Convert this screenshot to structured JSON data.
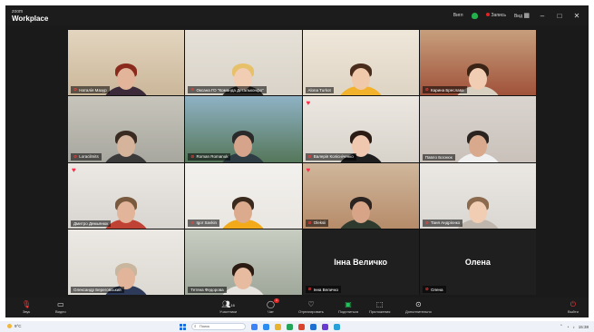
{
  "app": {
    "brand_small": "zoom",
    "brand_large": "Workplace"
  },
  "titlebar": {
    "view_label": "Вигл",
    "rec_label": "Запись",
    "grid_label": "Вид",
    "window_controls": [
      "minimize-icon",
      "maximize-icon",
      "close-icon"
    ]
  },
  "participants": [
    {
      "name": "Наталія Мазур",
      "mic_off": true,
      "heart": false,
      "bg": "#cbb79a",
      "wall": "#e3d5bf",
      "skin": "#e2b59b",
      "hair": "#8a2a1d",
      "shirt": "#3b2b3a"
    },
    {
      "name": "Оксана ГО \"Команда Детальконфо\"",
      "mic_off": true,
      "heart": false,
      "bg": "#d9d3c9",
      "wall": "#e6e1d8",
      "skin": "#f1cdb3",
      "hair": "#e7c06a",
      "shirt": "#2e2b28"
    },
    {
      "name": "Alona Turkot",
      "mic_off": false,
      "heart": false,
      "bg": "#ded4c4",
      "wall": "#efe7da",
      "skin": "#f0c8aa",
      "hair": "#4a2c1c",
      "shirt": "#f2b22b"
    },
    {
      "name": "Карина Бреслава",
      "mic_off": true,
      "heart": false,
      "bg": "#a0523a",
      "wall": "#c79f7d",
      "skin": "#f1cdb3",
      "hair": "#3b2416",
      "shirt": "#d8d0c0"
    },
    {
      "name": "Loracilmits",
      "mic_off": true,
      "heart": false,
      "bg": "#a8a79f",
      "wall": "#c7c5bb",
      "skin": "#d6b39b",
      "hair": "#3a2b22",
      "shirt": "#3a3a3a"
    },
    {
      "name": "Roman Romanuk",
      "mic_off": true,
      "heart": false,
      "bg": "#55775a",
      "wall": "#8fb2c5",
      "skin": "#d6a48a",
      "hair": "#2a2a2a",
      "shirt": "#2e3d44"
    },
    {
      "name": "Валерія Колісніченко",
      "mic_off": true,
      "heart": true,
      "bg": "#d7d2ca",
      "wall": "#ece8e1",
      "skin": "#f0c8b0",
      "hair": "#2a1b14",
      "shirt": "#1e1e1e"
    },
    {
      "name": "Павло Боснюк",
      "mic_off": false,
      "heart": false,
      "bg": "#c9c1ba",
      "wall": "#dad4cf",
      "skin": "#d9a98d",
      "hair": "#2a2320",
      "shirt": "#f0f0f0"
    },
    {
      "name": "Дмитро Демьянюк",
      "mic_off": false,
      "heart": true,
      "bg": "#d8d4cf",
      "wall": "#ece8e4",
      "skin": "#e2b49a",
      "hair": "#7a5a3e",
      "shirt": "#c04234"
    },
    {
      "name": "Igor Savkin",
      "mic_off": true,
      "heart": false,
      "bg": "#e9e6e1",
      "wall": "#f3f1ee",
      "skin": "#dcaa8c",
      "hair": "#3a2a1e",
      "shirt": "#f2a91a"
    },
    {
      "name": "Oleksii",
      "mic_off": true,
      "heart": true,
      "bg": "#b68c6a",
      "wall": "#d0b79c",
      "skin": "#d7a487",
      "hair": "#2a2320",
      "shirt": "#2f3a2f"
    },
    {
      "name": "Таня Андрієнко",
      "mic_off": true,
      "heart": false,
      "bg": "#dad7d2",
      "wall": "#ebe8e4",
      "skin": "#f1cdb3",
      "hair": "#8b6a4e",
      "shirt": "#bfb7ad"
    },
    {
      "name": "Олександр Береговський",
      "mic_off": false,
      "heart": false,
      "bg": "#dcd8d2",
      "wall": "#ece9e4",
      "skin": "#e2b49a",
      "hair": "#c9b69e",
      "shirt": "#2d3a5a"
    },
    {
      "name": "Тетяна Федорова",
      "mic_off": false,
      "heart": false,
      "bg": "#a0a79b",
      "wall": "#c8cdc2",
      "skin": "#e6bba0",
      "hair": "#2a1a12",
      "shirt": "#e7e3de",
      "active": true
    },
    {
      "name": "Інна Величко",
      "mic_off": true,
      "heart": false,
      "video_off": true
    },
    {
      "name": "Олена",
      "mic_off": true,
      "heart": false,
      "video_off": true
    }
  ],
  "toolbar": {
    "mute_label": "Звук",
    "video_label": "Видео",
    "participants_label": "Участники",
    "participants_count": "16",
    "chat_label": "Чат",
    "chat_badge": "1",
    "react_label": "Отреагировать",
    "share_label": "Поделиться",
    "apps_label": "Приложения",
    "more_label": "Дополнительно",
    "leave_label": "Выйти"
  },
  "taskbar": {
    "weather_label": "9°C",
    "search_placeholder": "Поиск",
    "time": "15:38"
  },
  "colors": {
    "toolbar_bg": "#1c1c1c",
    "active_speaker": "#23c25a",
    "mute_red": "#ff3b3b",
    "security_green": "#23b14d"
  }
}
